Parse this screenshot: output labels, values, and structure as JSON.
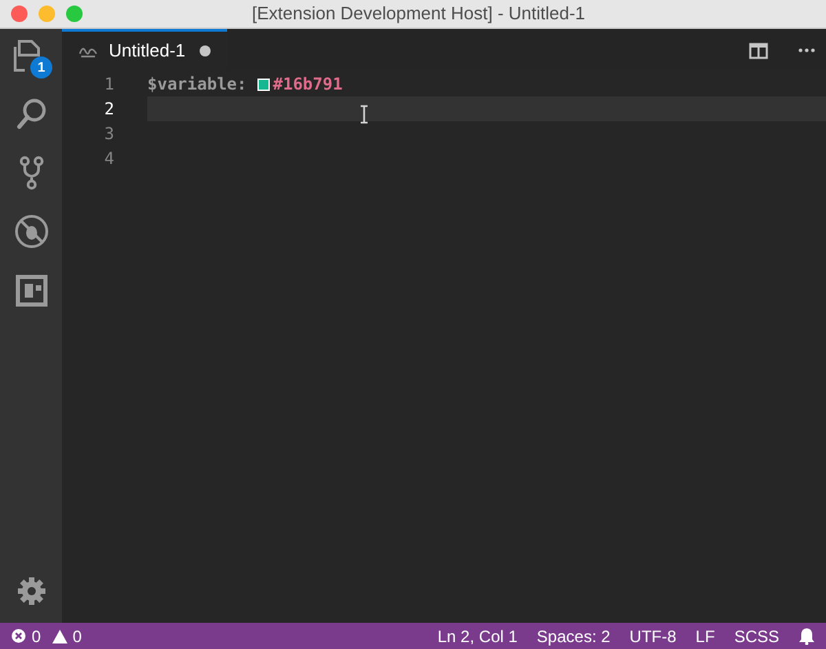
{
  "window": {
    "title": "[Extension Development Host] - Untitled-1"
  },
  "activity_bar": {
    "items": [
      {
        "kind": "files",
        "selected": false,
        "badge": "1"
      },
      {
        "kind": "search",
        "selected": false
      },
      {
        "kind": "git",
        "selected": false
      },
      {
        "kind": "debug",
        "selected": false
      },
      {
        "kind": "extensions",
        "selected": false
      }
    ]
  },
  "tabs": [
    {
      "label": "Untitled-1",
      "selected": true,
      "dirty": true
    }
  ],
  "editor": {
    "lines": [
      {
        "number": "1",
        "current": false,
        "tokens": [
          {
            "kind": "variable",
            "text": "$variable:"
          },
          {
            "kind": "swatch",
            "color": "#16b791"
          },
          {
            "kind": "color",
            "text": "#16b791"
          }
        ]
      },
      {
        "number": "2",
        "current": true
      },
      {
        "number": "3",
        "current": false
      },
      {
        "number": "4",
        "current": false
      }
    ]
  },
  "status_bar": {
    "errors": "0",
    "warnings": "0",
    "items": [
      "Ln 2, Col 1",
      "Spaces: 2",
      "UTF-8",
      "LF",
      "SCSS"
    ]
  }
}
